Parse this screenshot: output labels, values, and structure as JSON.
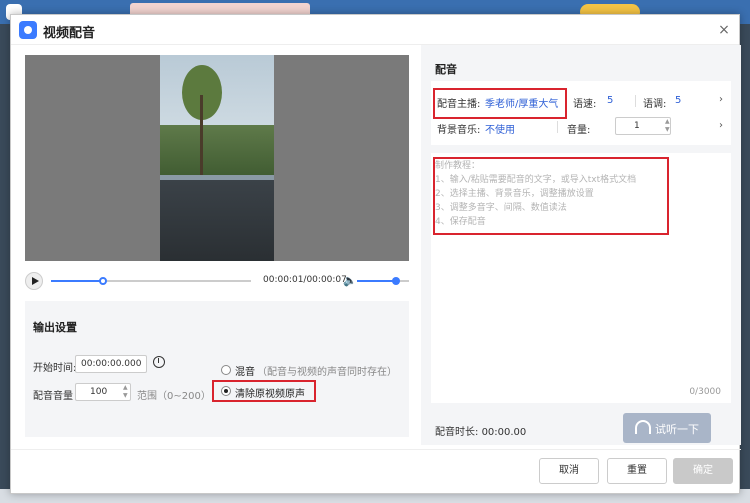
{
  "dialog": {
    "title": "视频配音",
    "close_glyph": "×"
  },
  "player": {
    "time": "00:00:01/00:00:07",
    "progress": 0.26,
    "volume": 0.75,
    "volume_icon": "🔈"
  },
  "output": {
    "title": "输出设置",
    "start_time_label": "开始时间:",
    "start_time_value": "00:00:00.000",
    "volume_label": "配音音量",
    "volume_value": "100",
    "volume_range": "范围（0~200）",
    "mix_label": "混音",
    "mix_hint": "（配音与视频的声音同时存在）",
    "clear_label": "清除原视频原声",
    "selected": "clear"
  },
  "dubbing": {
    "title": "配音",
    "anchor_label": "配音主播:",
    "anchor_value": "季老师/厚重大气",
    "speed_label": "语速:",
    "speed_value": "5",
    "tone_label": "语调:",
    "tone_value": "5",
    "bgm_label": "背景音乐:",
    "bgm_value": "不使用",
    "bgm_volume_label": "音量:",
    "bgm_volume_value": "1",
    "chevron": "›",
    "tutorial": [
      "制作教程：",
      "1、输入/粘贴需要配音的文字，或导入txt格式文档",
      "2、选择主播、背景音乐，调整播放设置",
      "3、调整多音字、间隔、数值读法",
      "4、保存配音"
    ],
    "counter": "0/3000",
    "duration_label": "配音时长:",
    "duration_value": "00:00.00",
    "listen_label": "试听一下"
  },
  "footer": {
    "cancel": "取消",
    "reset": "重置",
    "confirm": "确定"
  },
  "colors": {
    "accent": "#3b7bff",
    "highlight": "#d9242e",
    "link": "#2e5fd6"
  }
}
